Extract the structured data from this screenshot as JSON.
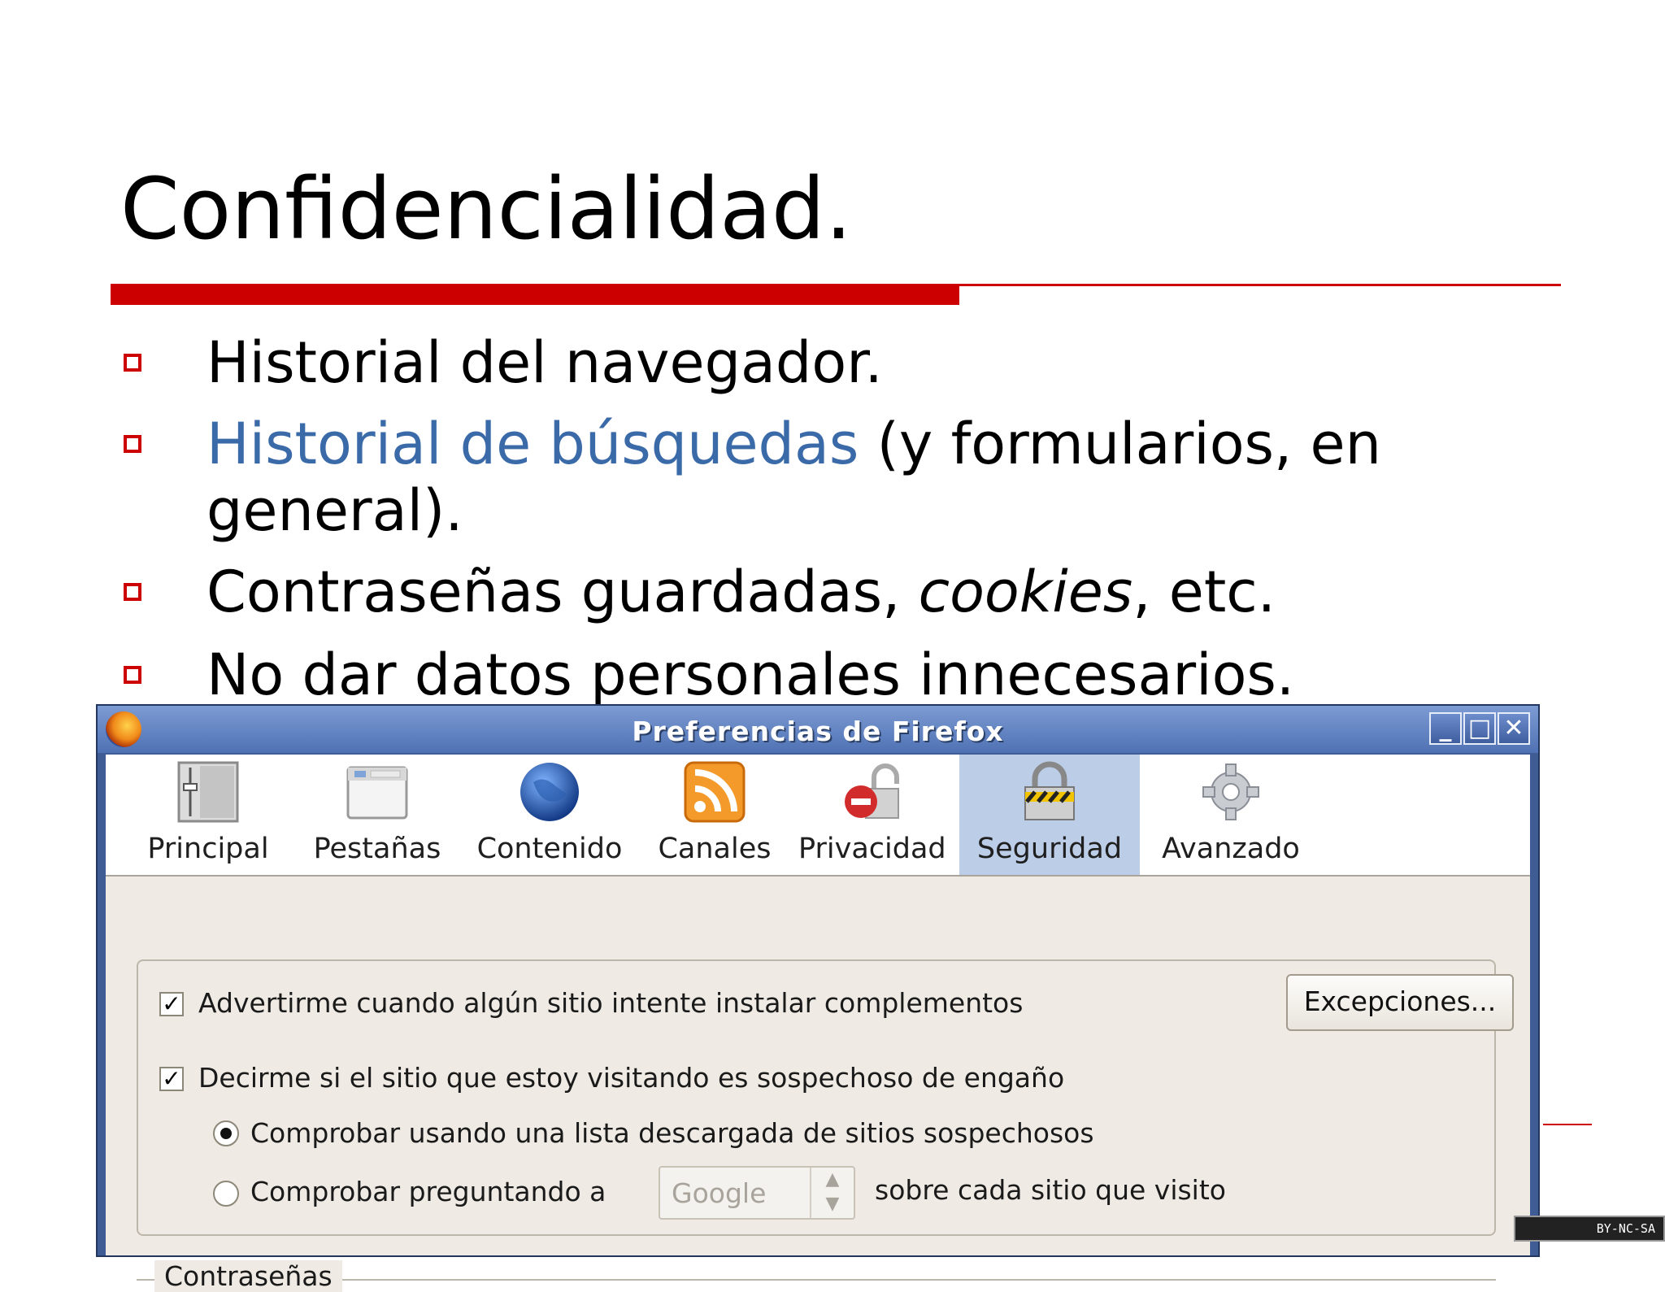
{
  "slide": {
    "title": "Confidencialidad.",
    "bullets": [
      {
        "text": "Historial del navegador."
      },
      {
        "link": "Historial de búsquedas",
        "rest": " (y formularios, en",
        "line2": "general)."
      },
      {
        "pre": "Contraseñas guardadas, ",
        "italic": "cookies",
        "post": ", etc."
      },
      {
        "text": "No dar datos personales innecesarios."
      }
    ],
    "accent_color": "#cc0000",
    "link_color": "#3a6aa8"
  },
  "dialog": {
    "title": "Preferencias de Firefox",
    "window_buttons": {
      "minimize": "_",
      "maximize": "□",
      "close": "✕"
    },
    "toolbar": [
      {
        "label": "Principal",
        "icon": "switch-panel-icon"
      },
      {
        "label": "Pestañas",
        "icon": "tabs-window-icon"
      },
      {
        "label": "Contenido",
        "icon": "globe-icon"
      },
      {
        "label": "Canales",
        "icon": "rss-feed-icon"
      },
      {
        "label": "Privacidad",
        "icon": "privacy-lock-icon"
      },
      {
        "label": "Seguridad",
        "icon": "padlock-icon",
        "selected": true
      },
      {
        "label": "Avanzado",
        "icon": "gear-icon"
      }
    ],
    "security": {
      "warn_addons_label": "Advertirme cuando algún sitio intente instalar complementos",
      "warn_addons_checked": true,
      "exceptions_button": "Excepciones...",
      "phishing_label": "Decirme si el sitio que estoy visitando es sospechoso de engaño",
      "phishing_checked": true,
      "radio_local_label": "Comprobar usando una lista descargada de sitios sospechosos",
      "radio_local_selected": true,
      "radio_ask_label": "Comprobar preguntando a",
      "provider_value": "Google",
      "radio_ask_suffix": "sobre cada sitio que visito"
    },
    "passwords_group_label": "Contraseñas"
  },
  "license_badge": "BY-NC-SA"
}
